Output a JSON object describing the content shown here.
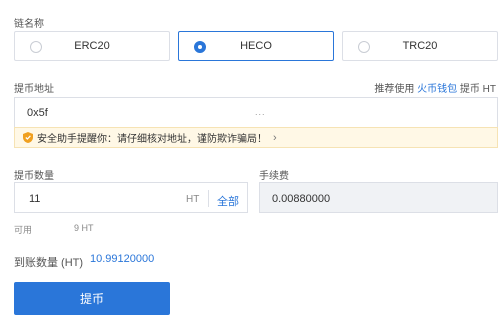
{
  "chain": {
    "label": "链名称",
    "options": [
      {
        "name": "ERC20",
        "selected": false
      },
      {
        "name": "HECO",
        "selected": true
      },
      {
        "name": "TRC20",
        "selected": false
      }
    ]
  },
  "address": {
    "label": "提币地址",
    "recommend_prefix": "推荐使用 ",
    "recommend_link": "火币钱包",
    "recommend_suffix": " 提币 HT",
    "value": "0x5f",
    "value_tail": "...",
    "warning": "安全助手提醒你：请仔细核对地址，谨防欺诈骗局！",
    "warning_arrow": "›"
  },
  "amount": {
    "label": "提币数量",
    "value": "11",
    "unit": "HT",
    "all_label": "全部",
    "available_prefix": "可用",
    "available_tail": "9 HT"
  },
  "fee": {
    "label": "手续费",
    "value": "0.00880000"
  },
  "receive": {
    "label": "到账数量 (HT)",
    "value": "10.99120000"
  },
  "submit_label": "提币",
  "colors": {
    "accent": "#2a76d9",
    "warning_bg": "#fff8e6",
    "fee_bg": "#f0f2f5"
  }
}
